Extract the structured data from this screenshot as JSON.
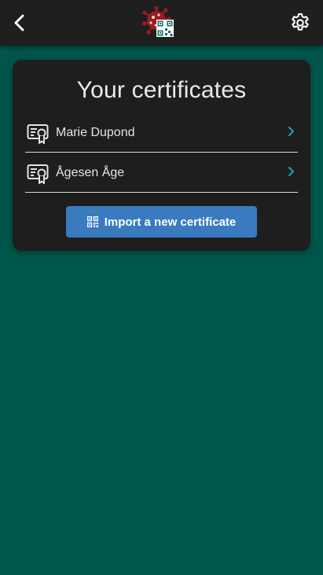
{
  "header": {
    "back_icon": "chevron-left-icon",
    "logo_icon": "virus-qr-logo",
    "settings_icon": "gear-icon"
  },
  "certificates": {
    "title": "Your certificates",
    "items": [
      {
        "name": "Marie Dupond",
        "icon": "certificate-icon"
      },
      {
        "name": "Ågesen Åge",
        "icon": "certificate-icon"
      }
    ],
    "import_label": "Import a new certificate",
    "import_icon": "qr-code-icon"
  },
  "colors": {
    "background": "#00564a",
    "header": "#1f1f1f",
    "card": "#1e1e1e",
    "accent_button": "#3a7bbf",
    "chevron": "#1aa3b5",
    "logo_red": "#9b1c22"
  }
}
